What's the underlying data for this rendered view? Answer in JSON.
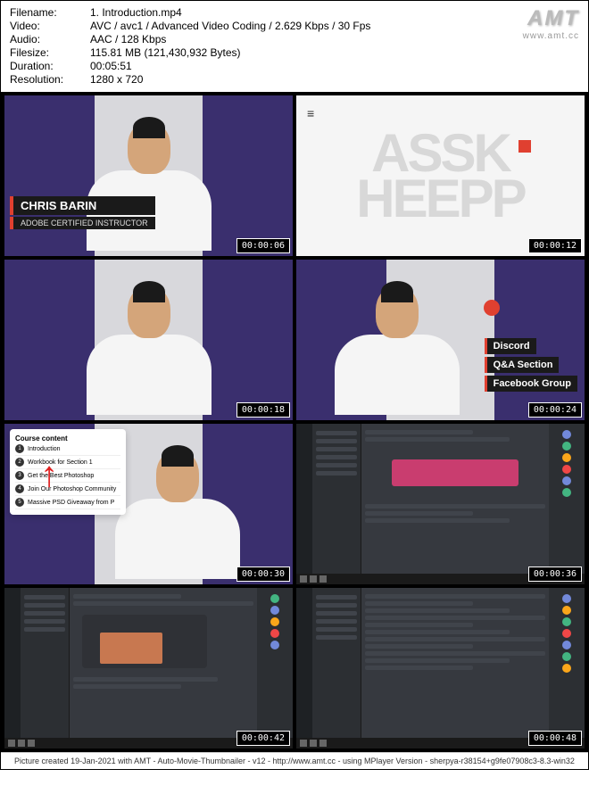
{
  "meta": {
    "filename_label": "Filename:",
    "filename": "1. Introduction.mp4",
    "video_label": "Video:",
    "video": "AVC / avc1 / Advanced Video Coding / 2.629 Kbps / 30 Fps",
    "audio_label": "Audio:",
    "audio": "AAC / 128 Kbps",
    "filesize_label": "Filesize:",
    "filesize": "115.81 MB (121,430,932 Bytes)",
    "duration_label": "Duration:",
    "duration": "00:05:51",
    "resolution_label": "Resolution:",
    "resolution": "1280 x 720"
  },
  "logo": {
    "main": "AMT",
    "sub": "www.amt.cc"
  },
  "thumbs": {
    "t1": {
      "time": "00:00:06",
      "name": "CHRIS BARIN",
      "title": "ADOBE CERTIFIED INSTRUCTOR"
    },
    "t2": {
      "time": "00:00:12",
      "letters_top": "ASSK",
      "letters_bot": "HEEPP"
    },
    "t3": {
      "time": "00:00:18"
    },
    "t4": {
      "time": "00:00:24",
      "c1": "Discord",
      "c2": "Q&A Section",
      "c3": "Facebook Group"
    },
    "t5": {
      "time": "00:00:30",
      "tip_title": "Course content",
      "tip1": "Introduction",
      "tip2": "Workbook for Section 1",
      "tip3": "Get the Best Photoshop",
      "tip4": "Join Our Photoshop Community",
      "tip5": "Massive PSD Giveaway from P"
    },
    "t6": {
      "time": "00:00:36"
    },
    "t7": {
      "time": "00:00:42"
    },
    "t8": {
      "time": "00:00:48"
    }
  },
  "footer": "Picture created 19-Jan-2021 with AMT - Auto-Movie-Thumbnailer - v12 - http://www.amt.cc - using MPlayer Version - sherpya-r38154+g9fe07908c3-8.3-win32"
}
